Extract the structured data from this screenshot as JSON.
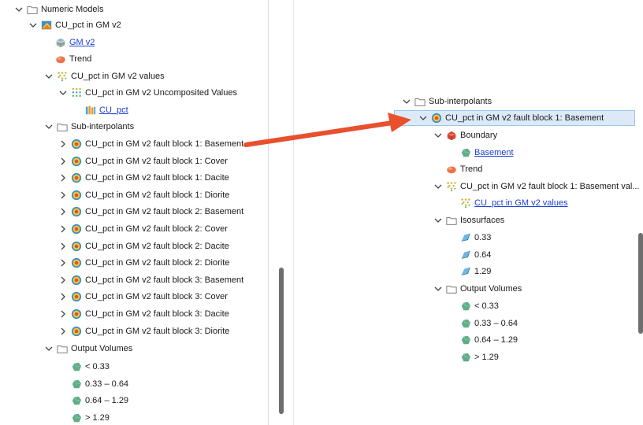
{
  "left": {
    "numeric_models": "Numeric Models",
    "model": "CU_pct in GM v2",
    "gm_link": "GM v2",
    "trend": "Trend",
    "values": "CU_pct in GM v2 values",
    "uncomposited": "CU_pct in GM v2 Uncomposited Values",
    "cu_pct_link": "CU_pct",
    "sub_interpolants": "Sub-interpolants",
    "fault_blocks": [
      "CU_pct in GM v2 fault block 1: Basement",
      "CU_pct in GM v2 fault block 1: Cover",
      "CU_pct in GM v2 fault block 1: Dacite",
      "CU_pct in GM v2 fault block 1: Diorite",
      "CU_pct in GM v2 fault block 2: Basement",
      "CU_pct in GM v2 fault block 2: Cover",
      "CU_pct in GM v2 fault block 2: Dacite",
      "CU_pct in GM v2 fault block 2: Diorite",
      "CU_pct in GM v2 fault block 3: Basement",
      "CU_pct in GM v2 fault block 3: Cover",
      "CU_pct in GM v2 fault block 3: Dacite",
      "CU_pct in GM v2 fault block 3: Diorite"
    ],
    "output_volumes": "Output Volumes",
    "volumes": [
      "< 0.33",
      "0.33 – 0.64",
      "0.64 – 1.29",
      "> 1.29"
    ]
  },
  "right": {
    "sub_interpolants": "Sub-interpolants",
    "selected": "CU_pct in GM v2 fault block 1: Basement",
    "boundary": "Boundary",
    "basement_link": "Basement",
    "trend": "Trend",
    "values_folder": "CU_pct in GM v2 fault block 1: Basement val...",
    "values_link": "CU_pct in GM v2 values",
    "isosurfaces": "Isosurfaces",
    "isos": [
      "0.33",
      "0.64",
      "1.29"
    ],
    "output_volumes": "Output Volumes",
    "volumes": [
      "< 0.33",
      "0.33 – 0.64",
      "0.64 – 1.29",
      "> 1.29"
    ]
  },
  "colors": {
    "arrow": "#e8502e",
    "link": "#1a3fd6",
    "selection": "#dceaf8",
    "volume": "#5fae8a"
  },
  "icons": {
    "folder": "folder-icon",
    "numeric_model": "numeric-model-icon",
    "geo_model": "geological-model-icon",
    "trend": "trend-icon",
    "points": "points-icon",
    "interpolant": "interpolant-icon",
    "boundary": "boundary-icon",
    "isosurface": "isosurface-icon",
    "volume": "volume-icon"
  }
}
